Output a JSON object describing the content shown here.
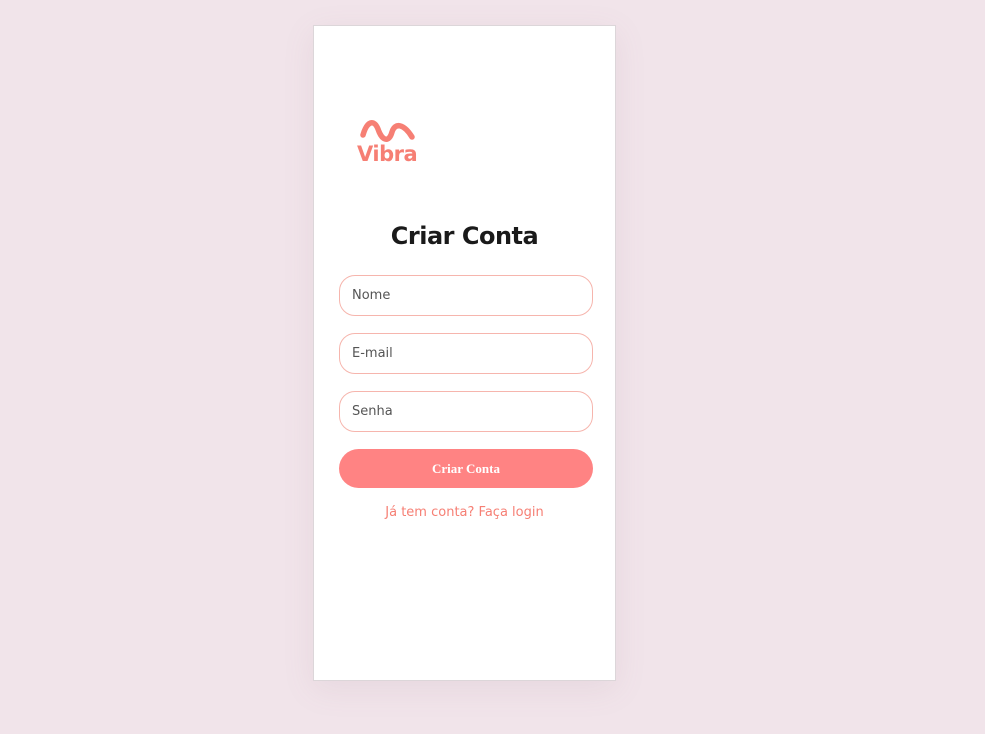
{
  "brand": {
    "name": "Vibra",
    "color": "#f67f74",
    "icon": "wave-icon"
  },
  "form": {
    "title": "Criar Conta",
    "name_placeholder": "Nome",
    "email_placeholder": "E-mail",
    "password_placeholder": "Senha",
    "submit_label": "Criar Conta",
    "submit_color": "#ff8383",
    "login_link": "Já tem conta? Faça login"
  },
  "theme": {
    "background": "#f1e4ea",
    "card": "#ffffff",
    "field_border": "#f6b5ad"
  }
}
